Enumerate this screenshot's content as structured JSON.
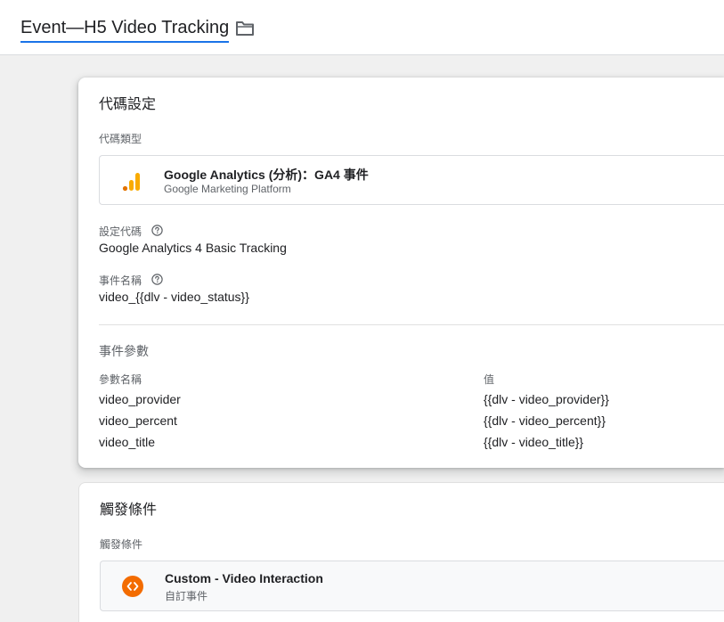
{
  "header": {
    "title": "Event—H5 Video Tracking",
    "folder_icon": "folder-icon"
  },
  "tag_config": {
    "card_title": "代碼設定",
    "type_label": "代碼類型",
    "type": {
      "icon": "google-analytics-icon",
      "name": "Google Analytics (分析)：GA4 事件",
      "subtitle": "Google Marketing Platform"
    },
    "config_tag_label": "設定代碼",
    "config_tag_value": "Google Analytics 4 Basic Tracking",
    "event_name_label": "事件名稱",
    "event_name_value": "video_{{dlv - video_status}}",
    "params_section_title": "事件參數",
    "params_columns": {
      "name": "參數名稱",
      "value": "值"
    },
    "params": [
      {
        "name": "video_provider",
        "value": "{{dlv - video_provider}}"
      },
      {
        "name": "video_percent",
        "value": "{{dlv - video_percent}}"
      },
      {
        "name": "video_title",
        "value": "{{dlv - video_title}}"
      }
    ]
  },
  "triggering": {
    "card_title": "觸發條件",
    "label": "觸發條件",
    "trigger": {
      "icon": "custom-event-icon",
      "name": "Custom - Video Interaction",
      "subtitle": "自訂事件"
    }
  },
  "colors": {
    "accent_blue": "#1a73e8",
    "ga_orange": "#f9ab00",
    "ga_dark_orange": "#e37400",
    "trigger_orange": "#f36c00"
  }
}
